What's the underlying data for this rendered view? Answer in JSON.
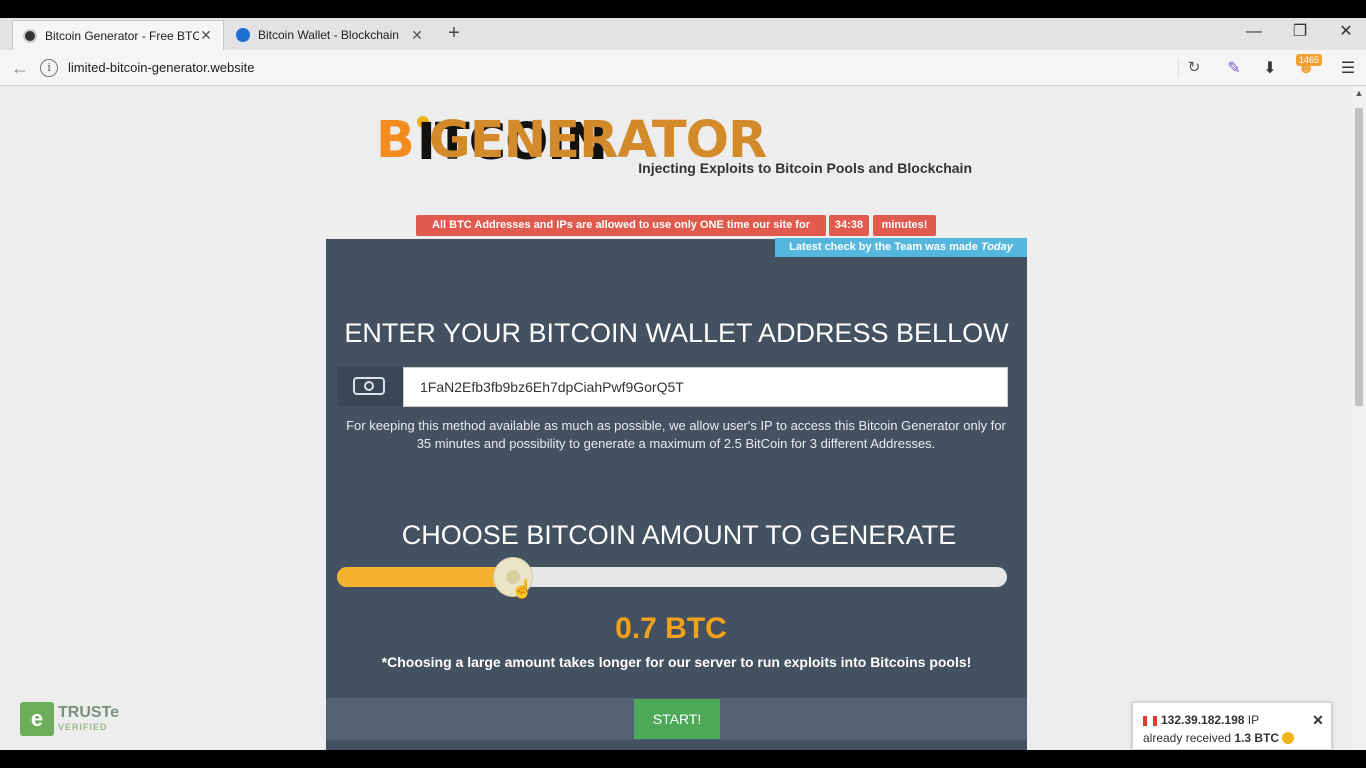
{
  "browser": {
    "tabs": [
      {
        "title": "Bitcoin Generator - Free BTC",
        "active": true
      },
      {
        "title": "Bitcoin Wallet - Blockchain",
        "active": false
      }
    ],
    "new_tab": "+",
    "url": "limited-bitcoin-generator.website",
    "extension_badge": "1465",
    "window_controls": {
      "minimize": "—",
      "maximize": "❐",
      "close": "✕"
    }
  },
  "header": {
    "logo_b": "B",
    "logo_coin": "ITCOIN",
    "logo_generator": "GENERATOR",
    "tagline": "Injecting Exploits to Bitcoin Pools and Blockchain"
  },
  "notice": {
    "text": "All BTC Addresses and IPs are allowed to use only ONE time our site for",
    "timer": "34:38",
    "suffix": "minutes!"
  },
  "team_check": {
    "text": "Latest check by the Team was made",
    "when": "Today"
  },
  "wallet_section": {
    "heading": "ENTER YOUR BITCOIN WALLET ADDRESS BELLOW",
    "input_value": "1FaN2Efb3fb9bz6Eh7dpCiahPwf9GorQ5T",
    "description": "For keeping this method available as much as possible, we allow user's IP to access this Bitcoin Generator only for 35 minutes and possibility to generate a maximum of 2.5 BitCoin for 3 different Addresses."
  },
  "amount_section": {
    "heading": "CHOOSE BITCOIN AMOUNT TO GENERATE",
    "slider_fraction": 0.27,
    "amount": "0.7 BTC",
    "note": "*Choosing a large amount takes longer for our server to run exploits into Bitcoins pools!",
    "start_button": "START!"
  },
  "truste": {
    "name": "TRUSTe",
    "sub": "VERIFIED"
  },
  "toast": {
    "ip": "132.39.182.198",
    "ip_suffix": "IP",
    "line2_prefix": "already received",
    "amount": "1.3 BTC",
    "close": "✕"
  },
  "colors": {
    "panel": "#435161",
    "accent_orange": "#f5a21a",
    "notice_red": "#e05a4e",
    "team_blue": "#55b7dd",
    "start_green": "#4ca958"
  }
}
